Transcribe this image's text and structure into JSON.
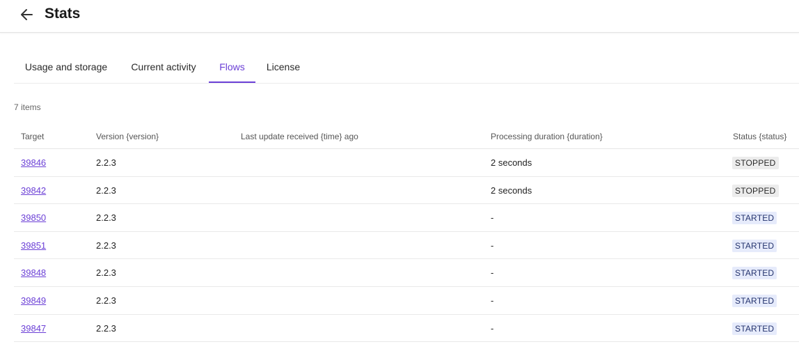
{
  "header": {
    "title": "Stats",
    "back_icon": "arrow-left-icon"
  },
  "tabs": [
    {
      "label": "Usage and storage",
      "active": false
    },
    {
      "label": "Current activity",
      "active": false
    },
    {
      "label": "Flows",
      "active": true
    },
    {
      "label": "License",
      "active": false
    }
  ],
  "items_count": "7 items",
  "table": {
    "columns": {
      "target": "Target",
      "version": "Version {version}",
      "time": "Last update received {time} ago",
      "duration": "Processing duration {duration}",
      "status": "Status {status}"
    },
    "rows": [
      {
        "target": "39846",
        "version": "2.2.3",
        "time": "",
        "duration": "2 seconds",
        "status": "STOPPED"
      },
      {
        "target": "39842",
        "version": "2.2.3",
        "time": "",
        "duration": "2 seconds",
        "status": "STOPPED"
      },
      {
        "target": "39850",
        "version": "2.2.3",
        "time": "",
        "duration": "-",
        "status": "STARTED"
      },
      {
        "target": "39851",
        "version": "2.2.3",
        "time": "",
        "duration": "-",
        "status": "STARTED"
      },
      {
        "target": "39848",
        "version": "2.2.3",
        "time": "",
        "duration": "-",
        "status": "STARTED"
      },
      {
        "target": "39849",
        "version": "2.2.3",
        "time": "",
        "duration": "-",
        "status": "STARTED"
      },
      {
        "target": "39847",
        "version": "2.2.3",
        "time": "",
        "duration": "-",
        "status": "STARTED"
      }
    ]
  },
  "colors": {
    "accent": "#6b3fd6",
    "stopped_bg": "#ececec",
    "started_bg": "#e6ebfb",
    "started_text": "#24336e"
  }
}
